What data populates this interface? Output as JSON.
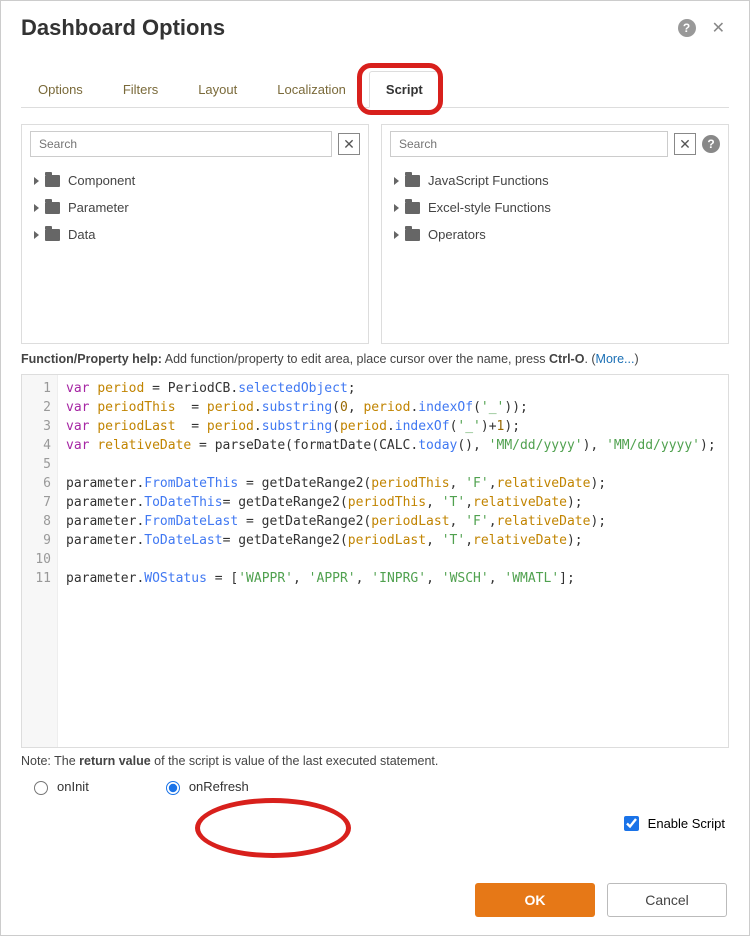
{
  "header": {
    "title": "Dashboard Options"
  },
  "tabs": [
    "Options",
    "Filters",
    "Layout",
    "Localization",
    "Script"
  ],
  "activeTab": "Script",
  "leftPanel": {
    "placeholder": "Search",
    "items": [
      "Component",
      "Parameter",
      "Data"
    ]
  },
  "rightPanel": {
    "placeholder": "Search",
    "items": [
      "JavaScript Functions",
      "Excel-style Functions",
      "Operators"
    ]
  },
  "helpLine": {
    "label": "Function/Property help:",
    "text": " Add function/property to edit area, place cursor over the name, press ",
    "shortcut": "Ctrl-O",
    "more": "More..."
  },
  "code": {
    "lines": [
      1,
      2,
      3,
      4,
      5,
      6,
      7,
      8,
      9,
      10,
      11
    ],
    "raw": "var period = PeriodCB.selectedObject;\nvar periodThis  = period.substring(0, period.indexOf('_'));\nvar periodLast  = period.substring(period.indexOf('_')+1);\nvar relativeDate = parseDate(formatDate(CALC.today(), 'MM/dd/yyyy'), 'MM/dd/yyyy');\n\nparameter.FromDateThis = getDateRange2(periodThis, 'F',relativeDate);\nparameter.ToDateThis= getDateRange2(periodThis, 'T',relativeDate);\nparameter.FromDateLast = getDateRange2(periodLast, 'F',relativeDate);\nparameter.ToDateLast= getDateRange2(periodLast, 'T',relativeDate);\n\nparameter.WOStatus = ['WAPPR', 'APPR', 'INPRG', 'WSCH', 'WMATL'];"
  },
  "noteLine": {
    "prefix": "Note: The ",
    "bold": "return value",
    "suffix": " of the script is value of the last executed statement."
  },
  "radios": {
    "onInit": "onInit",
    "onRefresh": "onRefresh",
    "selected": "onRefresh"
  },
  "enableScript": {
    "label": "Enable Script",
    "checked": true
  },
  "buttons": {
    "ok": "OK",
    "cancel": "Cancel"
  }
}
